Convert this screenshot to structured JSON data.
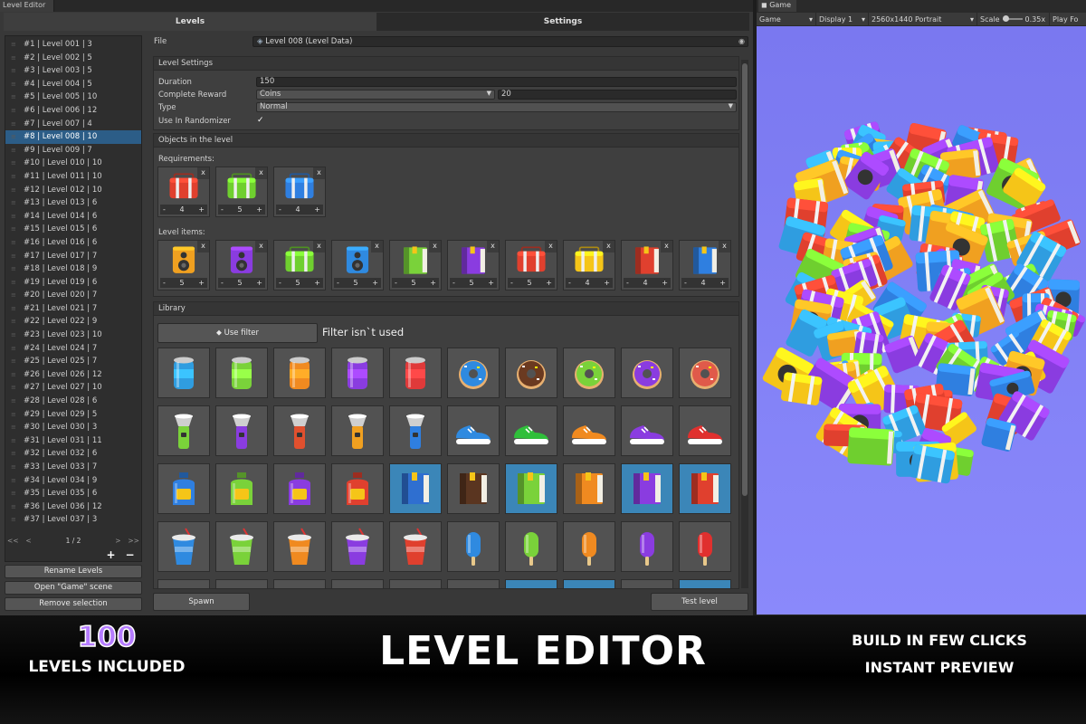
{
  "editor": {
    "window_tab": "Level Editor",
    "tabs": [
      "Levels",
      "Settings"
    ],
    "active_tab": 0,
    "levels": [
      "#1 | Level 001 | 3",
      "#2 | Level 002 | 5",
      "#3 | Level 003 | 5",
      "#4 | Level 004 | 5",
      "#5 | Level 005 | 10",
      "#6 | Level 006 | 12",
      "#7 | Level 007 | 4",
      "#8 | Level 008 | 10",
      "#9 | Level 009 | 7",
      "#10 | Level 010 | 10",
      "#11 | Level 011 | 10",
      "#12 | Level 012 | 10",
      "#13 | Level 013 | 6",
      "#14 | Level 014 | 6",
      "#15 | Level 015 | 6",
      "#16 | Level 016 | 6",
      "#17 | Level 017 | 7",
      "#18 | Level 018 | 9",
      "#19 | Level 019 | 6",
      "#20 | Level 020 | 7",
      "#21 | Level 021 | 7",
      "#22 | Level 022 | 9",
      "#23 | Level 023 | 10",
      "#24 | Level 024 | 7",
      "#25 | Level 025 | 7",
      "#26 | Level 026 | 12",
      "#27 | Level 027 | 10",
      "#28 | Level 028 | 6",
      "#29 | Level 029 | 5",
      "#30 | Level 030 | 3",
      "#31 | Level 031 | 11",
      "#32 | Level 032 | 6",
      "#33 | Level 033 | 7",
      "#34 | Level 034 | 9",
      "#35 | Level 035 | 6",
      "#36 | Level 036 | 12",
      "#37 | Level 037 | 3"
    ],
    "selected_level": 7,
    "pager": {
      "first": "<<",
      "prev": "<",
      "page": "1 / 2",
      "next": ">",
      "last": ">>"
    },
    "list_add": "+",
    "list_remove": "−",
    "side_buttons": [
      "Rename Levels",
      "Open \"Game\" scene",
      "Remove selection"
    ],
    "file_label": "File",
    "file_value": "Level 008 (Level Data)",
    "settings": {
      "header": "Level Settings",
      "duration_label": "Duration",
      "duration_value": "150",
      "reward_label": "Complete Reward",
      "reward_currency": "Coins",
      "reward_amount": "20",
      "type_label": "Type",
      "type_value": "Normal",
      "randomizer_label": "Use In Randomizer",
      "randomizer_checked": "✓"
    },
    "objects": {
      "header": "Objects in the level",
      "requirements_label": "Requirements:",
      "requirements": [
        {
          "icon": "red-suitcase",
          "count": "4",
          "color": "#e0402e"
        },
        {
          "icon": "green-suitcase",
          "count": "5",
          "color": "#6fcf2f"
        },
        {
          "icon": "blue-suitcase",
          "count": "4",
          "color": "#2f7fe0"
        }
      ],
      "items_label": "Level items:",
      "items": [
        {
          "icon": "orange-speaker",
          "count": "5",
          "color": "#f0a020"
        },
        {
          "icon": "purple-speaker",
          "count": "5",
          "color": "#8a3ce0"
        },
        {
          "icon": "green-suitcase",
          "count": "5",
          "color": "#6fcf2f"
        },
        {
          "icon": "blue-speaker",
          "count": "5",
          "color": "#2f8ae0"
        },
        {
          "icon": "green-book",
          "count": "5",
          "color": "#7ad23a"
        },
        {
          "icon": "purple-book",
          "count": "5",
          "color": "#8a3ce0"
        },
        {
          "icon": "red-suitcase",
          "count": "5",
          "color": "#e0402e"
        },
        {
          "icon": "yellow-suitcase",
          "count": "4",
          "color": "#f5c518"
        },
        {
          "icon": "red-book",
          "count": "4",
          "color": "#e0402e"
        },
        {
          "icon": "blue-book",
          "count": "4",
          "color": "#2f7fe0"
        }
      ],
      "remove_glyph": "x",
      "minus_glyph": "-",
      "plus_glyph": "+"
    },
    "library": {
      "header": "Library",
      "filter_button": "Use filter",
      "filter_status": "Filter isn`t used",
      "rows": [
        [
          {
            "icon": "can",
            "color": "#2f9de0"
          },
          {
            "icon": "can",
            "color": "#7ad23a"
          },
          {
            "icon": "can",
            "color": "#f08a20"
          },
          {
            "icon": "can",
            "color": "#8a3ce0"
          },
          {
            "icon": "can",
            "color": "#e03a3a"
          },
          {
            "icon": "donut",
            "color": "#2f8ae0"
          },
          {
            "icon": "donut",
            "color": "#6b3a20"
          },
          {
            "icon": "donut",
            "color": "#7ad23a"
          },
          {
            "icon": "donut",
            "color": "#8a3ce0"
          },
          {
            "icon": "donut",
            "color": "#e05a4a"
          }
        ],
        [
          {
            "icon": "flashlight",
            "color": "#7ad23a"
          },
          {
            "icon": "flashlight",
            "color": "#8a3ce0"
          },
          {
            "icon": "flashlight",
            "color": "#e0502e"
          },
          {
            "icon": "flashlight",
            "color": "#f0a020"
          },
          {
            "icon": "flashlight",
            "color": "#2f7fe0"
          },
          {
            "icon": "sneaker",
            "color": "#2f8ae0"
          },
          {
            "icon": "sneaker",
            "color": "#2fbf3a"
          },
          {
            "icon": "sneaker",
            "color": "#f08a20"
          },
          {
            "icon": "sneaker",
            "color": "#8a3ce0"
          },
          {
            "icon": "sneaker",
            "color": "#e0302e"
          }
        ],
        [
          {
            "icon": "bottle",
            "color": "#2f7fe0"
          },
          {
            "icon": "bottle",
            "color": "#7ad23a"
          },
          {
            "icon": "bottle",
            "color": "#8a3ce0"
          },
          {
            "icon": "bottle",
            "color": "#e0402e"
          },
          {
            "icon": "book",
            "color": "#2f6fd0",
            "highlight": true
          },
          {
            "icon": "book",
            "color": "#5a3520"
          },
          {
            "icon": "book",
            "color": "#7ad23a",
            "highlight": true
          },
          {
            "icon": "book",
            "color": "#f08a20"
          },
          {
            "icon": "book",
            "color": "#8a3ce0",
            "highlight": true
          },
          {
            "icon": "book",
            "color": "#e0402e",
            "highlight": true
          }
        ],
        [
          {
            "icon": "cup",
            "color": "#2f8ae0"
          },
          {
            "icon": "cup",
            "color": "#7ad23a"
          },
          {
            "icon": "cup",
            "color": "#f08a20"
          },
          {
            "icon": "cup",
            "color": "#8a3ce0"
          },
          {
            "icon": "cup",
            "color": "#e0402e"
          },
          {
            "icon": "popsicle",
            "color": "#2f8ae0"
          },
          {
            "icon": "popsicle",
            "color": "#7ad23a"
          },
          {
            "icon": "popsicle",
            "color": "#f08a20"
          },
          {
            "icon": "popsicle",
            "color": "#8a3ce0"
          },
          {
            "icon": "popsicle",
            "color": "#e0302e"
          }
        ]
      ]
    },
    "spawn_button": "Spawn",
    "test_button": "Test level"
  },
  "game": {
    "tab": "Game",
    "display_mode": "Game",
    "display": "Display 1",
    "resolution": "2560x1440 Portrait",
    "scale_label": "Scale",
    "scale_value": "0.35x",
    "play_focused": "Play Fo"
  },
  "banner": {
    "count": "100",
    "count_caption": "LEVELS INCLUDED",
    "title": "LEVEL EDITOR",
    "feature_1": "BUILD IN FEW CLICKS",
    "feature_2": "INSTANT PREVIEW",
    "count_color": "#b57cff"
  }
}
